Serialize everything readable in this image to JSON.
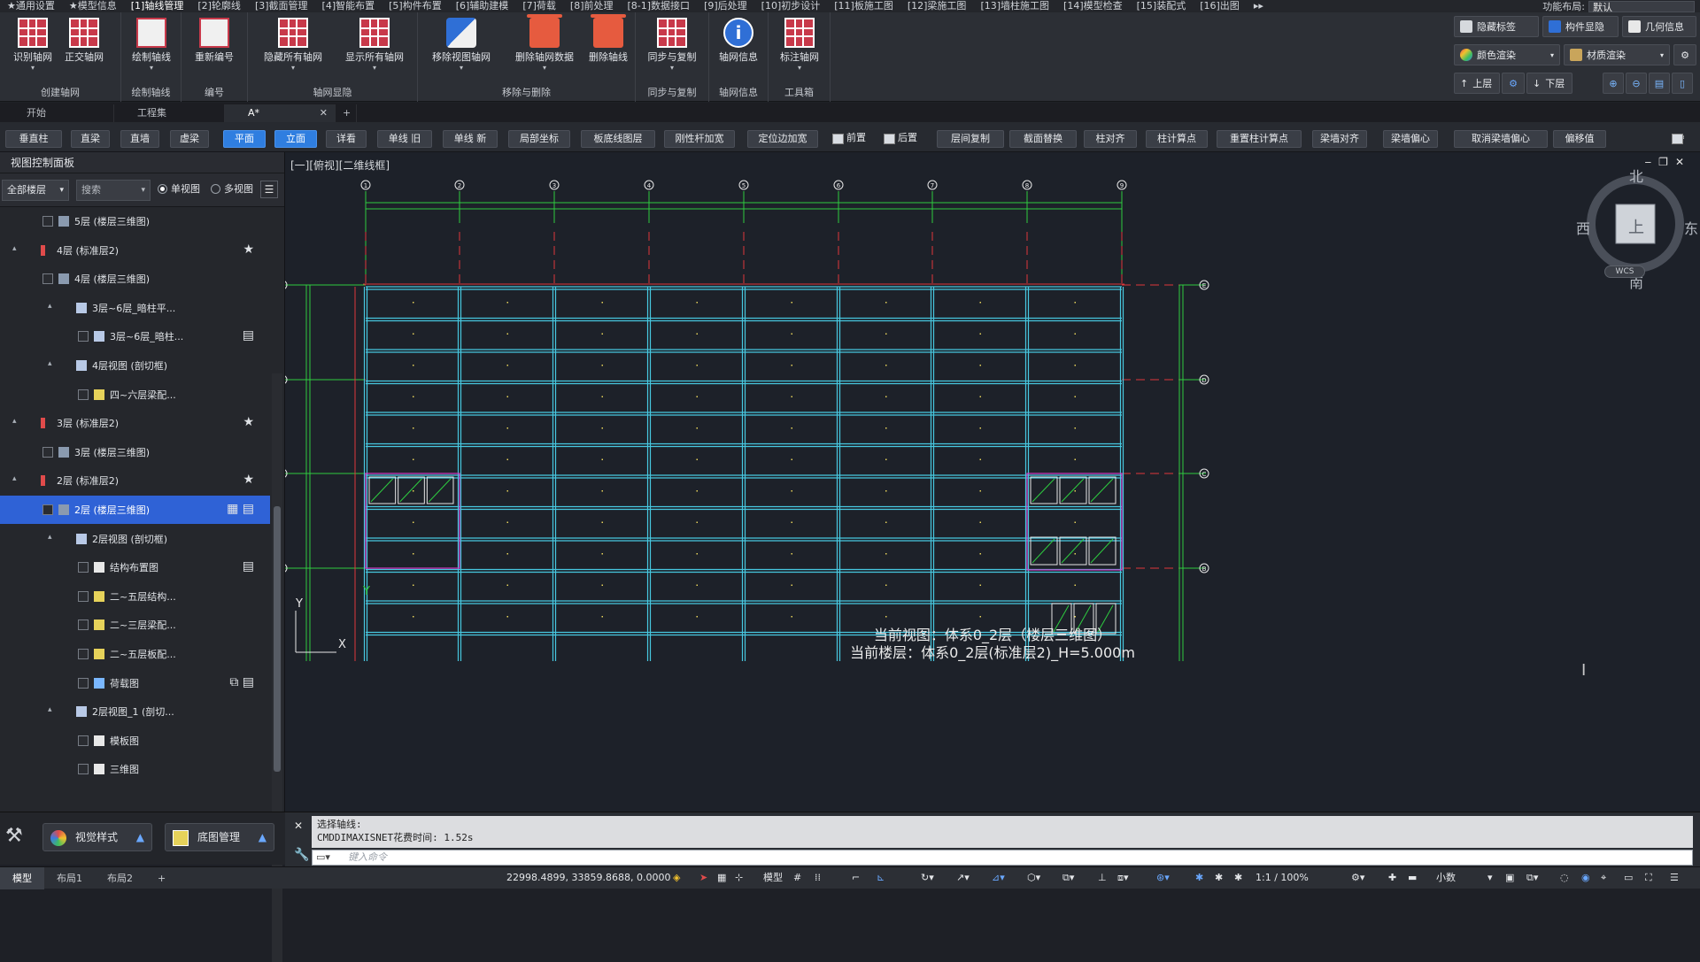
{
  "menubar": {
    "items": [
      "★通用设置",
      "★模型信息",
      "[1]轴线管理",
      "[2]轮廓线",
      "[3]截面管理",
      "[4]智能布置",
      "[5]构件布置",
      "[6]辅助建模",
      "[7]荷载",
      "[8]前处理",
      "[8-1]数据接口",
      "[9]后处理",
      "[10]初步设计",
      "[11]板施工图",
      "[12]梁施工图",
      "[13]墙柱施工图",
      "[14]模型检查",
      "[15]装配式",
      "[16]出图"
    ],
    "more": "▸▸",
    "function_layout_label": "功能布局:",
    "function_layout_value": "默认"
  },
  "ribbon": {
    "groups": [
      {
        "label": "创建轴网",
        "buttons": [
          "识别轴网",
          "正交轴网"
        ]
      },
      {
        "label": "绘制轴线",
        "buttons": [
          "绘制轴线"
        ]
      },
      {
        "label": "编号",
        "buttons": [
          "重新编号"
        ]
      },
      {
        "label": "轴网显隐",
        "buttons": [
          "隐藏所有轴网",
          "显示所有轴网"
        ]
      },
      {
        "label": "移除与删除",
        "buttons": [
          "移除视图轴网",
          "删除轴网数据",
          "删除轴线"
        ]
      },
      {
        "label": "同步与复制",
        "buttons": [
          "同步与复制"
        ]
      },
      {
        "label": "轴网信息",
        "buttons": [
          "轴网信息"
        ]
      },
      {
        "label": "工具箱",
        "buttons": [
          "标注轴网"
        ]
      }
    ],
    "right": {
      "hide_tags": "隐藏标签",
      "member_display": "构件显隐",
      "geometry_info": "几何信息",
      "color_render": "颜色渲染",
      "material_render": "材质渲染",
      "up_floor": "上层",
      "down_floor": "下层",
      "help": "?"
    }
  },
  "doc_tabs": [
    {
      "label": "开始"
    },
    {
      "label": "工程集"
    },
    {
      "label": "A*"
    },
    {
      "label": "+"
    }
  ],
  "commands": [
    "垂直柱",
    "直梁",
    "直墙",
    "虚梁",
    "平面",
    "立面",
    "详看",
    "单线 旧",
    "单线 新",
    "局部坐标",
    "板底线图层",
    "刚性杆加宽",
    "定位边加宽",
    "前置",
    "后置",
    "层间复制",
    "截面替换",
    "柱对齐",
    "柱计算点",
    "重置柱计算点",
    "梁墙对齐",
    "梁墙偏心",
    "取消梁墙偏心",
    "偏移值"
  ],
  "panel": {
    "title": "视图控制面板",
    "floor_filter": "全部楼层",
    "search_placeholder": "搜索",
    "single_view": "单视图",
    "multi_view": "多视图",
    "tree": [
      {
        "label": "5层 (楼层三维图)"
      },
      {
        "label": "4层 (标准层2)"
      },
      {
        "label": "4层 (楼层三维图)"
      },
      {
        "label": "3层~6层_暗柱平..."
      },
      {
        "label": "3层~6层_暗柱..."
      },
      {
        "label": "4层视图 (剖切框)"
      },
      {
        "label": "四~六层梁配..."
      },
      {
        "label": "3层 (标准层2)"
      },
      {
        "label": "3层 (楼层三维图)"
      },
      {
        "label": "2层 (标准层2)"
      },
      {
        "label": "2层 (楼层三维图)"
      },
      {
        "label": "2层视图 (剖切框)"
      },
      {
        "label": "结构布置图"
      },
      {
        "label": "二~五层结构..."
      },
      {
        "label": "二~三层梁配..."
      },
      {
        "label": "二~五层板配..."
      },
      {
        "label": "荷载图"
      },
      {
        "label": "2层视图_1 (剖切..."
      },
      {
        "label": "模板图"
      },
      {
        "label": "三维图"
      },
      {
        "label": "场地-2层_暗柱平..."
      }
    ],
    "bottom": {
      "visual_style": "视觉样式",
      "base_map": "底图管理"
    }
  },
  "viewport": {
    "title": "[一][俯视][二维线框]",
    "compass": {
      "north": "北",
      "south": "南",
      "east": "东",
      "west": "西",
      "top": "上",
      "wcs": "WCS"
    },
    "axes_top": [
      "1",
      "2",
      "3",
      "4",
      "5",
      "6",
      "7",
      "8",
      "9"
    ],
    "axes_side": [
      "E",
      "D",
      "C",
      "B"
    ],
    "ucs_x": "X",
    "ucs_y": "Y",
    "current_view": "当前视图：体系0_2层（楼层三维图）",
    "current_floor": "当前楼层：体系0_2层(标准层2)_H=5.000m"
  },
  "command_line": {
    "history": [
      "选择轴线:",
      "CMDDIMAXISNET花费时间: 1.52s"
    ],
    "placeholder": "键入命令"
  },
  "statusbar": {
    "tabs": [
      "模型",
      "布局1",
      "布局2",
      "+"
    ],
    "coords": "22998.4899, 33859.8688, 0.0000",
    "model": "模型",
    "scale": "1:1 / 100%",
    "units": "小数"
  },
  "colors": {
    "accent": "#2f7ee0",
    "grid_line": "#e0373b",
    "axis_line": "#2ecc40",
    "beam": "#47c8e0",
    "slab_pink": "#d23bc6",
    "background": "#1d2129"
  }
}
